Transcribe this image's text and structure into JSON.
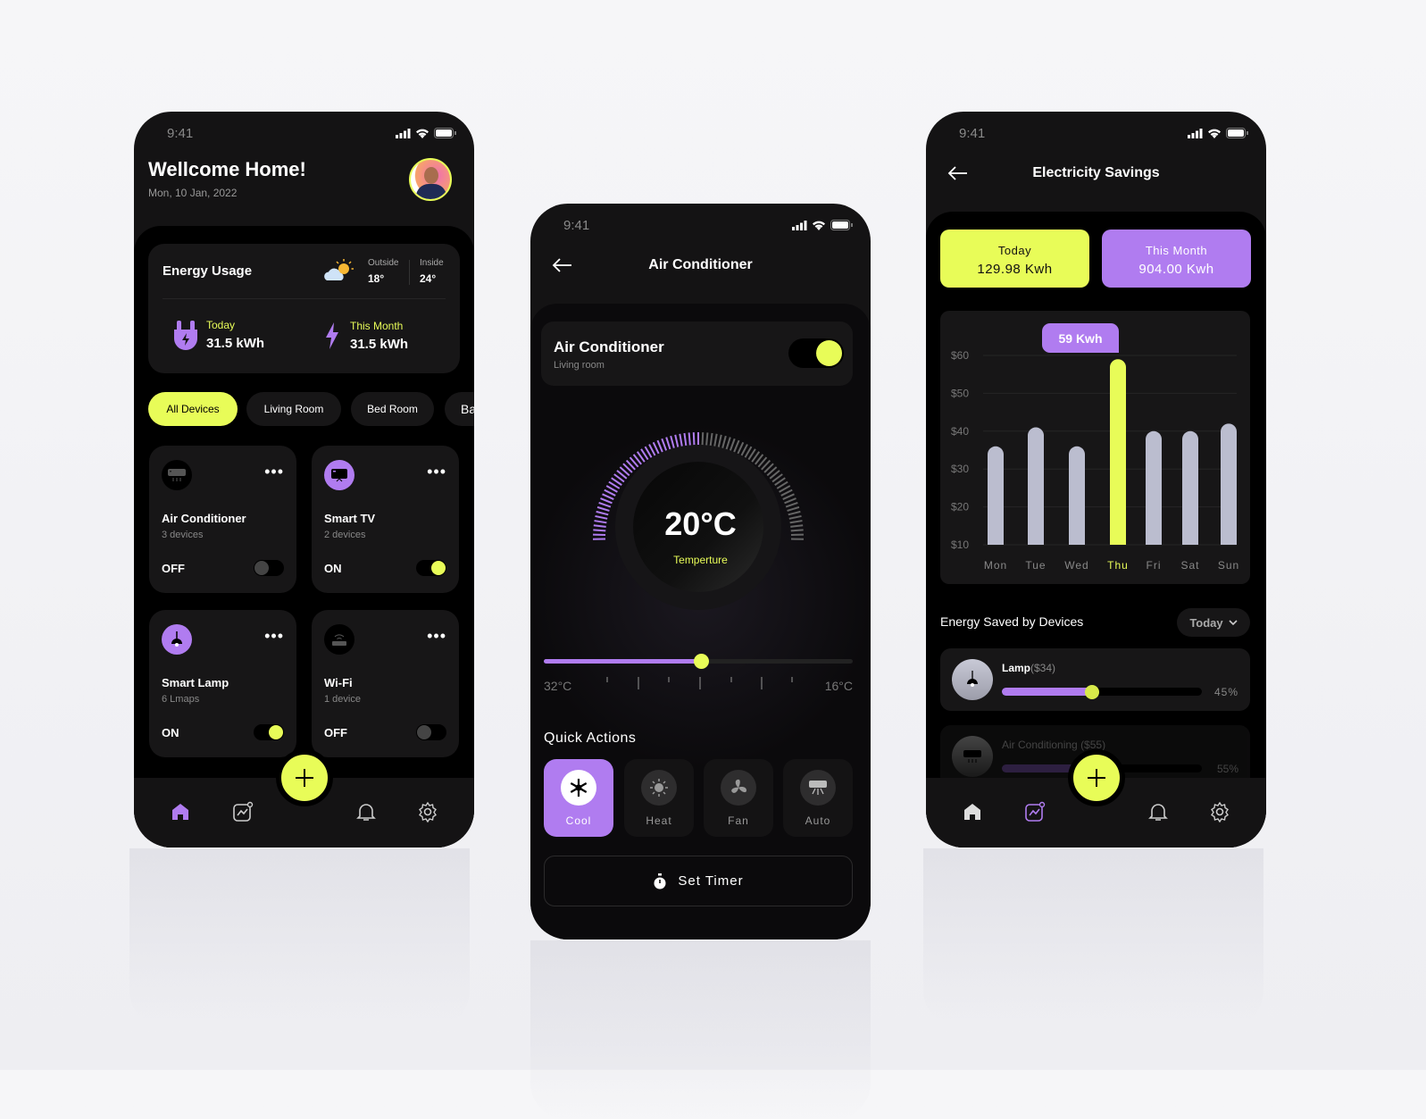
{
  "colors": {
    "accent_yellow": "#e8fc58",
    "accent_purple": "#b07cf0",
    "background": "#000000",
    "card": "#171617"
  },
  "status_time": "9:41",
  "home": {
    "title": "Wellcome Home!",
    "date": "Mon, 10 Jan, 2022",
    "energy": {
      "title": "Energy Usage",
      "outside_label": "Outside",
      "outside_value": "18°",
      "inside_label": "Inside",
      "inside_value": "24°",
      "today_label": "Today",
      "today_value": "31.5 kWh",
      "month_label": "This Month",
      "month_value": "31.5 kWh"
    },
    "filters": [
      {
        "label": "All Devices",
        "active": true
      },
      {
        "label": "Living Room"
      },
      {
        "label": "Bed Room"
      },
      {
        "label": "Ba"
      }
    ],
    "devices": [
      {
        "name": "Air Conditioner",
        "sub": "3 devices",
        "status": "OFF",
        "on": false,
        "icon": "air-conditioner-icon"
      },
      {
        "name": "Smart TV",
        "sub": "2 devices",
        "status": "ON",
        "on": true,
        "icon": "tv-icon"
      },
      {
        "name": "Smart Lamp",
        "sub": "6 Lmaps",
        "status": "ON",
        "on": true,
        "icon": "lamp-icon"
      },
      {
        "name": "Wi-Fi",
        "sub": "1 device",
        "status": "OFF",
        "on": false,
        "icon": "router-icon"
      }
    ],
    "nav_active": "home"
  },
  "ac": {
    "title": "Air Conditioner",
    "device_name": "Air Conditioner",
    "room": "Living room",
    "power_on": true,
    "temperature": "20°C",
    "temperature_label": "Temperture",
    "slider": {
      "min_label": "32°C",
      "max_label": "16°C",
      "fraction": 0.51
    },
    "quick_actions_title": "Quick Actions",
    "modes": [
      {
        "label": "Cool",
        "active": true,
        "icon": "snowflake-icon"
      },
      {
        "label": "Heat",
        "icon": "sun-icon"
      },
      {
        "label": "Fan",
        "icon": "fan-icon"
      },
      {
        "label": "Auto",
        "icon": "air-conditioner-icon"
      }
    ],
    "timer_label": "Set Timer"
  },
  "savings": {
    "title": "Electricity Savings",
    "today_label": "Today",
    "today_value": "129.98 Kwh",
    "month_label": "This Month",
    "month_value": "904.00 Kwh",
    "tooltip": "59 Kwh",
    "section_title": "Energy Saved by Devices",
    "period": "Today",
    "items": [
      {
        "name": "Lamp",
        "amount": "($34)",
        "percent": "45%",
        "fraction": 0.45
      },
      {
        "name": "Air Conditioning",
        "amount": "($55)",
        "percent": "55%",
        "fraction": 0.55
      }
    ],
    "nav_active": "stats"
  },
  "chart_data": {
    "type": "bar",
    "categories": [
      "Mon",
      "Tue",
      "Wed",
      "Thu",
      "Fri",
      "Sat",
      "Sun"
    ],
    "values": [
      36,
      41,
      36,
      59,
      40,
      40,
      42
    ],
    "highlight": "Thu",
    "yticks": [
      "$60",
      "$50",
      "$40",
      "$30",
      "$20",
      "$10"
    ],
    "ylim": [
      10,
      60
    ],
    "grid": true
  }
}
